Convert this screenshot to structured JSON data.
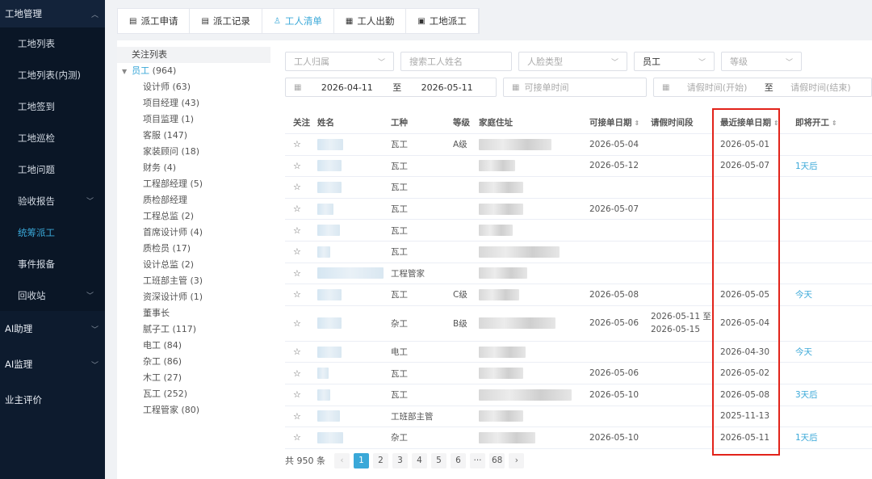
{
  "sidebar": {
    "top_group": "工地管理",
    "items": [
      {
        "label": "工地列表"
      },
      {
        "label": "工地列表(内测)"
      },
      {
        "label": "工地签到"
      },
      {
        "label": "工地巡检"
      },
      {
        "label": "工地问题"
      },
      {
        "label": "验收报告"
      },
      {
        "label": "统筹派工"
      },
      {
        "label": "事件报备"
      },
      {
        "label": "回收站"
      }
    ],
    "groups": [
      {
        "label": "AI助理"
      },
      {
        "label": "AI监理"
      },
      {
        "label": "业主评价"
      }
    ]
  },
  "tabs": [
    {
      "label": "派工申请"
    },
    {
      "label": "派工记录"
    },
    {
      "label": "工人清单"
    },
    {
      "label": "工人出勤"
    },
    {
      "label": "工地派工"
    }
  ],
  "tree": {
    "header": "关注列表",
    "root_label": "员工",
    "root_count": "(964)",
    "nodes": [
      "设计师 (63)",
      "项目经理 (43)",
      "项目监理 (1)",
      "客服 (147)",
      "家装顾问 (18)",
      "财务 (4)",
      "工程部经理 (5)",
      "质检部经理",
      "工程总监 (2)",
      "首席设计师 (4)",
      "质检员 (17)",
      "设计总监 (2)",
      "工班部主管 (3)",
      "资深设计师 (1)",
      "董事长",
      "腻子工 (117)",
      "电工 (84)",
      "杂工 (86)",
      "木工 (27)",
      "瓦工 (252)",
      "工程管家 (80)"
    ]
  },
  "filters": {
    "worker_belong": "工人归属",
    "search": "搜索工人姓名",
    "face_type": "人脸类型",
    "role": "员工",
    "level": "等级",
    "date_start": "2026-04-11",
    "date_to": "至",
    "date_end": "2026-05-11",
    "available_time": "可接单时间",
    "leave_start": "请假时间(开始)",
    "leave_to": "至",
    "leave_end": "请假时间(结束)"
  },
  "table": {
    "headers": {
      "follow": "关注",
      "name": "姓名",
      "type": "工种",
      "level": "等级",
      "address": "家庭住址",
      "available": "可接单日期",
      "leave": "请假时间段",
      "recent": "最近接单日期",
      "start": "即将开工"
    },
    "rows": [
      {
        "type": "瓦工",
        "level": "A级",
        "available": "2026-05-04",
        "leave": "",
        "recent": "2026-05-01",
        "start": ""
      },
      {
        "type": "瓦工",
        "level": "",
        "available": "2026-05-12",
        "leave": "",
        "recent": "2026-05-07",
        "start": "1天后"
      },
      {
        "type": "瓦工",
        "level": "",
        "available": "",
        "leave": "",
        "recent": "",
        "start": ""
      },
      {
        "type": "瓦工",
        "level": "",
        "available": "2026-05-07",
        "leave": "",
        "recent": "",
        "start": ""
      },
      {
        "type": "瓦工",
        "level": "",
        "available": "",
        "leave": "",
        "recent": "",
        "start": ""
      },
      {
        "type": "瓦工",
        "level": "",
        "available": "",
        "leave": "",
        "recent": "",
        "start": ""
      },
      {
        "type": "工程管家",
        "level": "",
        "available": "",
        "leave": "",
        "recent": "",
        "start": ""
      },
      {
        "type": "瓦工",
        "level": "C级",
        "available": "2026-05-08",
        "leave": "",
        "recent": "2026-05-05",
        "start": "今天"
      },
      {
        "type": "杂工",
        "level": "B级",
        "available": "2026-05-06",
        "leave": "2026-05-11 至 2026-05-15",
        "recent": "2026-05-04",
        "start": ""
      },
      {
        "type": "电工",
        "level": "",
        "available": "",
        "leave": "",
        "recent": "2026-04-30",
        "start": "今天"
      },
      {
        "type": "瓦工",
        "level": "",
        "available": "2026-05-06",
        "leave": "",
        "recent": "2026-05-02",
        "start": ""
      },
      {
        "type": "瓦工",
        "level": "",
        "available": "2026-05-10",
        "leave": "",
        "recent": "2026-05-08",
        "start": "3天后"
      },
      {
        "type": "工班部主管",
        "level": "",
        "available": "",
        "leave": "",
        "recent": "2025-11-13",
        "start": ""
      },
      {
        "type": "杂工",
        "level": "",
        "available": "2026-05-10",
        "leave": "",
        "recent": "2026-05-11",
        "start": "1天后"
      }
    ]
  },
  "pagination": {
    "total": "共 950 条",
    "pages": [
      "1",
      "2",
      "3",
      "4",
      "5",
      "6",
      "···",
      "68"
    ]
  },
  "colors": {
    "accent": "#3aa8d8",
    "highlight": "#e2231a",
    "sidebar": "#0d1b2e"
  }
}
